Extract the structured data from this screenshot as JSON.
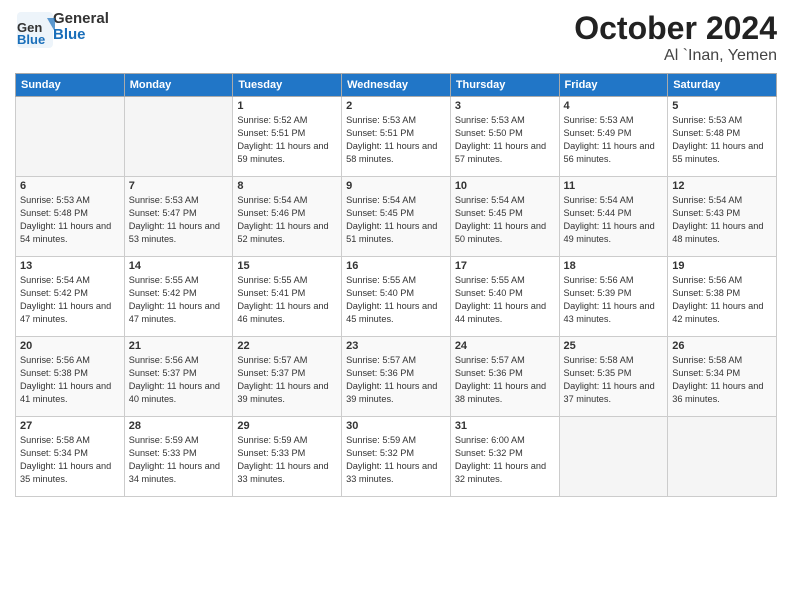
{
  "header": {
    "logo_general": "General",
    "logo_blue": "Blue",
    "title": "October 2024",
    "location": "Al `Inan, Yemen"
  },
  "days_of_week": [
    "Sunday",
    "Monday",
    "Tuesday",
    "Wednesday",
    "Thursday",
    "Friday",
    "Saturday"
  ],
  "weeks": [
    [
      {
        "day": null
      },
      {
        "day": null
      },
      {
        "day": "1",
        "sunrise": "5:52 AM",
        "sunset": "5:51 PM",
        "daylight": "11 hours and 59 minutes."
      },
      {
        "day": "2",
        "sunrise": "5:53 AM",
        "sunset": "5:51 PM",
        "daylight": "11 hours and 58 minutes."
      },
      {
        "day": "3",
        "sunrise": "5:53 AM",
        "sunset": "5:50 PM",
        "daylight": "11 hours and 57 minutes."
      },
      {
        "day": "4",
        "sunrise": "5:53 AM",
        "sunset": "5:49 PM",
        "daylight": "11 hours and 56 minutes."
      },
      {
        "day": "5",
        "sunrise": "5:53 AM",
        "sunset": "5:48 PM",
        "daylight": "11 hours and 55 minutes."
      }
    ],
    [
      {
        "day": "6",
        "sunrise": "5:53 AM",
        "sunset": "5:48 PM",
        "daylight": "11 hours and 54 minutes."
      },
      {
        "day": "7",
        "sunrise": "5:53 AM",
        "sunset": "5:47 PM",
        "daylight": "11 hours and 53 minutes."
      },
      {
        "day": "8",
        "sunrise": "5:54 AM",
        "sunset": "5:46 PM",
        "daylight": "11 hours and 52 minutes."
      },
      {
        "day": "9",
        "sunrise": "5:54 AM",
        "sunset": "5:45 PM",
        "daylight": "11 hours and 51 minutes."
      },
      {
        "day": "10",
        "sunrise": "5:54 AM",
        "sunset": "5:45 PM",
        "daylight": "11 hours and 50 minutes."
      },
      {
        "day": "11",
        "sunrise": "5:54 AM",
        "sunset": "5:44 PM",
        "daylight": "11 hours and 49 minutes."
      },
      {
        "day": "12",
        "sunrise": "5:54 AM",
        "sunset": "5:43 PM",
        "daylight": "11 hours and 48 minutes."
      }
    ],
    [
      {
        "day": "13",
        "sunrise": "5:54 AM",
        "sunset": "5:42 PM",
        "daylight": "11 hours and 47 minutes."
      },
      {
        "day": "14",
        "sunrise": "5:55 AM",
        "sunset": "5:42 PM",
        "daylight": "11 hours and 47 minutes."
      },
      {
        "day": "15",
        "sunrise": "5:55 AM",
        "sunset": "5:41 PM",
        "daylight": "11 hours and 46 minutes."
      },
      {
        "day": "16",
        "sunrise": "5:55 AM",
        "sunset": "5:40 PM",
        "daylight": "11 hours and 45 minutes."
      },
      {
        "day": "17",
        "sunrise": "5:55 AM",
        "sunset": "5:40 PM",
        "daylight": "11 hours and 44 minutes."
      },
      {
        "day": "18",
        "sunrise": "5:56 AM",
        "sunset": "5:39 PM",
        "daylight": "11 hours and 43 minutes."
      },
      {
        "day": "19",
        "sunrise": "5:56 AM",
        "sunset": "5:38 PM",
        "daylight": "11 hours and 42 minutes."
      }
    ],
    [
      {
        "day": "20",
        "sunrise": "5:56 AM",
        "sunset": "5:38 PM",
        "daylight": "11 hours and 41 minutes."
      },
      {
        "day": "21",
        "sunrise": "5:56 AM",
        "sunset": "5:37 PM",
        "daylight": "11 hours and 40 minutes."
      },
      {
        "day": "22",
        "sunrise": "5:57 AM",
        "sunset": "5:37 PM",
        "daylight": "11 hours and 39 minutes."
      },
      {
        "day": "23",
        "sunrise": "5:57 AM",
        "sunset": "5:36 PM",
        "daylight": "11 hours and 39 minutes."
      },
      {
        "day": "24",
        "sunrise": "5:57 AM",
        "sunset": "5:36 PM",
        "daylight": "11 hours and 38 minutes."
      },
      {
        "day": "25",
        "sunrise": "5:58 AM",
        "sunset": "5:35 PM",
        "daylight": "11 hours and 37 minutes."
      },
      {
        "day": "26",
        "sunrise": "5:58 AM",
        "sunset": "5:34 PM",
        "daylight": "11 hours and 36 minutes."
      }
    ],
    [
      {
        "day": "27",
        "sunrise": "5:58 AM",
        "sunset": "5:34 PM",
        "daylight": "11 hours and 35 minutes."
      },
      {
        "day": "28",
        "sunrise": "5:59 AM",
        "sunset": "5:33 PM",
        "daylight": "11 hours and 34 minutes."
      },
      {
        "day": "29",
        "sunrise": "5:59 AM",
        "sunset": "5:33 PM",
        "daylight": "11 hours and 33 minutes."
      },
      {
        "day": "30",
        "sunrise": "5:59 AM",
        "sunset": "5:32 PM",
        "daylight": "11 hours and 33 minutes."
      },
      {
        "day": "31",
        "sunrise": "6:00 AM",
        "sunset": "5:32 PM",
        "daylight": "11 hours and 32 minutes."
      },
      {
        "day": null
      },
      {
        "day": null
      }
    ]
  ]
}
